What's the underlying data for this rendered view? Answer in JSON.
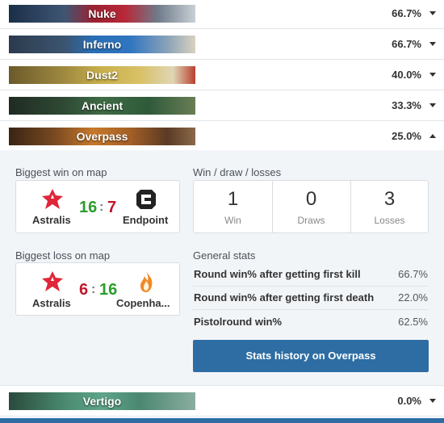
{
  "maps": [
    {
      "name": "Nuke",
      "pct": "66.7%"
    },
    {
      "name": "Inferno",
      "pct": "66.7%"
    },
    {
      "name": "Dust2",
      "pct": "40.0%"
    },
    {
      "name": "Ancient",
      "pct": "33.3%"
    },
    {
      "name": "Overpass",
      "pct": "25.0%"
    },
    {
      "name": "Vertigo",
      "pct": "0.0%"
    }
  ],
  "overpass": {
    "biggest_win": {
      "label": "Biggest win on map",
      "team1": "Astralis",
      "team2": "Endpoint",
      "score1": "16",
      "score2": "7",
      "sep": ":"
    },
    "biggest_loss": {
      "label": "Biggest loss on map",
      "team1": "Astralis",
      "team2": "Copenha...",
      "score1": "6",
      "score2": "16",
      "sep": ":"
    },
    "wdl": {
      "label": "Win / draw / losses",
      "win": "1",
      "win_label": "Win",
      "draw": "0",
      "draw_label": "Draws",
      "loss": "3",
      "loss_label": "Losses"
    },
    "general": {
      "label": "General stats",
      "rows": [
        {
          "k": "Round win% after getting first kill",
          "v": "66.7%"
        },
        {
          "k": "Round win% after getting first death",
          "v": "22.0%"
        },
        {
          "k": "Pistolround win%",
          "v": "62.5%"
        }
      ]
    },
    "button": "Stats history on Overpass"
  },
  "colors": {
    "win": "#2a9d2a",
    "loss": "#c0172a",
    "accent": "#2d6da3"
  }
}
